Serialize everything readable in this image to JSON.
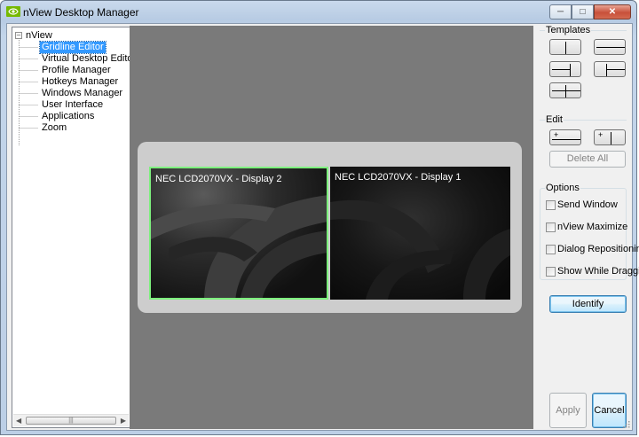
{
  "window": {
    "title": "nView Desktop Manager"
  },
  "tree": {
    "root": "nView",
    "items": [
      {
        "label": "Gridline Editor",
        "selected": true
      },
      {
        "label": "Virtual Desktop Editor",
        "selected": false
      },
      {
        "label": "Profile Manager",
        "selected": false
      },
      {
        "label": "Hotkeys Manager",
        "selected": false
      },
      {
        "label": "Windows Manager",
        "selected": false
      },
      {
        "label": "User Interface",
        "selected": false
      },
      {
        "label": "Applications",
        "selected": false
      },
      {
        "label": "Zoom",
        "selected": false
      }
    ]
  },
  "displays": [
    {
      "label": "NEC LCD2070VX - Display 2",
      "selected": true
    },
    {
      "label": "NEC LCD2070VX - Display 1",
      "selected": false
    }
  ],
  "templates": {
    "label": "Templates"
  },
  "edit": {
    "label": "Edit",
    "delete_all": "Delete All"
  },
  "options": {
    "label": "Options",
    "items": [
      {
        "label": "Send Window",
        "checked": false
      },
      {
        "label": "nView Maximize",
        "checked": false
      },
      {
        "label": "Dialog Repositioning",
        "checked": false
      },
      {
        "label": "Show While Dragging",
        "checked": false
      }
    ]
  },
  "buttons": {
    "identify": "Identify",
    "apply": "Apply",
    "cancel": "Cancel"
  },
  "colors": {
    "selection": "#3399ff",
    "selected_display_border": "#7df07d",
    "workspace": "#7a7a7a"
  }
}
